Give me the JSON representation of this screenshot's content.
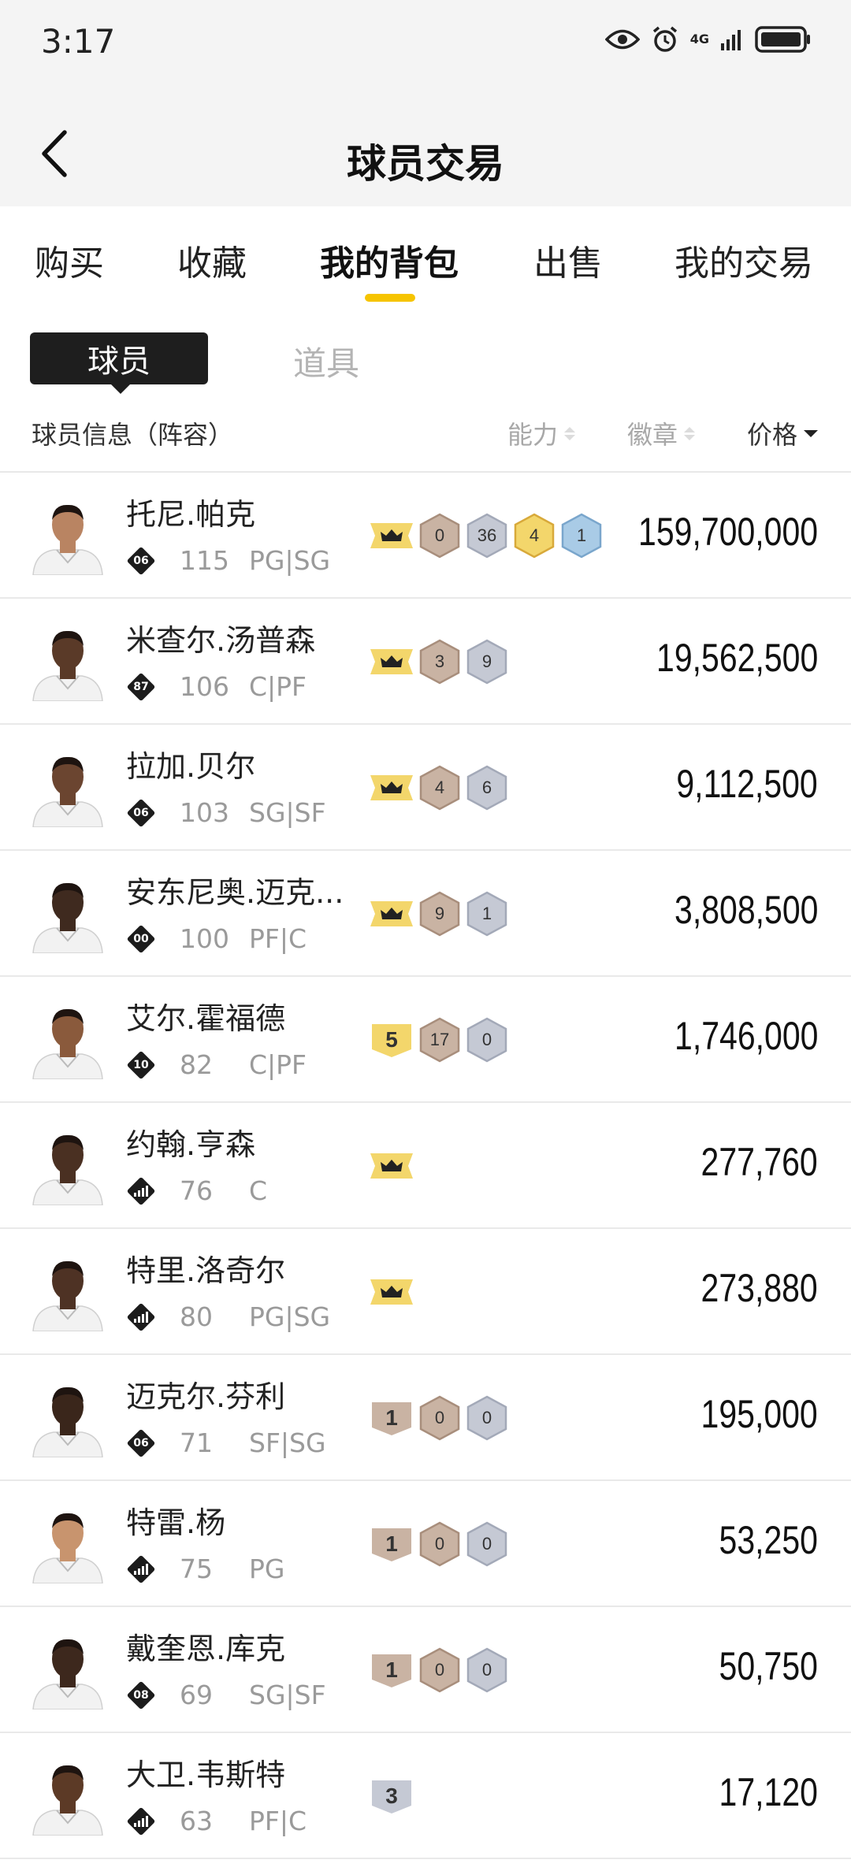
{
  "status_bar": {
    "time": "3:17",
    "network": "4G"
  },
  "header": {
    "title": "球员交易"
  },
  "main_tabs": [
    "购买",
    "收藏",
    "我的背包",
    "出售",
    "我的交易"
  ],
  "sub_tabs": {
    "active": "球员",
    "inactive": "道具"
  },
  "columns": {
    "info": "球员信息（阵容）",
    "ability": "能力",
    "badges": "徽章",
    "price": "价格"
  },
  "colors": {
    "accent": "#f6c400",
    "gold": "#f3d66b",
    "bronze": "#c9b3a3",
    "silver": "#c5c9d4",
    "blue": "#a9cbe6"
  },
  "players": [
    {
      "name": "托尼.帕克",
      "team": "06",
      "ovr": "115",
      "pos": "PG|SG",
      "price": "159,700,000",
      "badges": [
        {
          "kind": "crown"
        },
        {
          "kind": "hex",
          "tier": "bronze",
          "v": "0"
        },
        {
          "kind": "hex",
          "tier": "silver",
          "v": "36"
        },
        {
          "kind": "hex",
          "tier": "gold",
          "v": "4"
        },
        {
          "kind": "hex",
          "tier": "blue",
          "v": "1"
        }
      ]
    },
    {
      "name": "米查尔.汤普森",
      "team": "87",
      "ovr": "106",
      "pos": "C|PF",
      "price": "19,562,500",
      "badges": [
        {
          "kind": "crown"
        },
        {
          "kind": "hex",
          "tier": "bronze",
          "v": "3"
        },
        {
          "kind": "hex",
          "tier": "silver",
          "v": "9"
        }
      ]
    },
    {
      "name": "拉加.贝尔",
      "team": "06",
      "ovr": "103",
      "pos": "SG|SF",
      "price": "9,112,500",
      "badges": [
        {
          "kind": "crown"
        },
        {
          "kind": "hex",
          "tier": "bronze",
          "v": "4"
        },
        {
          "kind": "hex",
          "tier": "silver",
          "v": "6"
        }
      ]
    },
    {
      "name": "安东尼奥.迈克...",
      "team": "00",
      "ovr": "100",
      "pos": "PF|C",
      "price": "3,808,500",
      "badges": [
        {
          "kind": "crown"
        },
        {
          "kind": "hex",
          "tier": "bronze",
          "v": "9"
        },
        {
          "kind": "hex",
          "tier": "silver",
          "v": "1"
        }
      ]
    },
    {
      "name": "艾尔.霍福德",
      "team": "10",
      "ovr": "82",
      "pos": "C|PF",
      "price": "1,746,000",
      "badges": [
        {
          "kind": "rank",
          "tier": "gold",
          "v": "5"
        },
        {
          "kind": "hex",
          "tier": "bronze",
          "v": "17"
        },
        {
          "kind": "hex",
          "tier": "silver",
          "v": "0"
        }
      ]
    },
    {
      "name": "约翰.亨森",
      "team": "",
      "ovr": "76",
      "pos": "C",
      "price": "277,760",
      "badges": [
        {
          "kind": "crown"
        }
      ]
    },
    {
      "name": "特里.洛奇尔",
      "team": "",
      "ovr": "80",
      "pos": "PG|SG",
      "price": "273,880",
      "badges": [
        {
          "kind": "crown"
        }
      ]
    },
    {
      "name": "迈克尔.芬利",
      "team": "06",
      "ovr": "71",
      "pos": "SF|SG",
      "price": "195,000",
      "badges": [
        {
          "kind": "rank",
          "tier": "bronze",
          "v": "1"
        },
        {
          "kind": "hex",
          "tier": "bronze",
          "v": "0"
        },
        {
          "kind": "hex",
          "tier": "silver",
          "v": "0"
        }
      ]
    },
    {
      "name": "特雷.杨",
      "team": "",
      "ovr": "75",
      "pos": "PG",
      "price": "53,250",
      "badges": [
        {
          "kind": "rank",
          "tier": "bronze",
          "v": "1"
        },
        {
          "kind": "hex",
          "tier": "bronze",
          "v": "0"
        },
        {
          "kind": "hex",
          "tier": "silver",
          "v": "0"
        }
      ]
    },
    {
      "name": "戴奎恩.库克",
      "team": "08",
      "ovr": "69",
      "pos": "SG|SF",
      "price": "50,750",
      "badges": [
        {
          "kind": "rank",
          "tier": "bronze",
          "v": "1"
        },
        {
          "kind": "hex",
          "tier": "bronze",
          "v": "0"
        },
        {
          "kind": "hex",
          "tier": "silver",
          "v": "0"
        }
      ]
    },
    {
      "name": "大卫.韦斯特",
      "team": "",
      "ovr": "63",
      "pos": "PF|C",
      "price": "17,120",
      "badges": [
        {
          "kind": "rank",
          "tier": "silver",
          "v": "3"
        }
      ]
    }
  ]
}
